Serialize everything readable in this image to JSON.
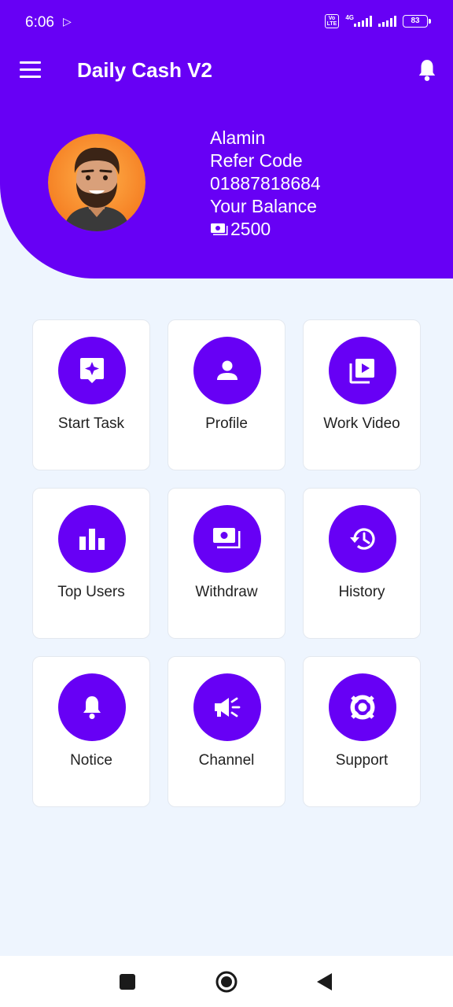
{
  "status_bar": {
    "time": "6:06",
    "network": "4G",
    "volte": "Vo LTE",
    "battery": "83"
  },
  "app_bar": {
    "title": "Daily Cash V2"
  },
  "profile": {
    "name": "Alamin",
    "refer_label": "Refer Code",
    "refer_code": "01887818684",
    "balance_label": "Your Balance",
    "balance": "2500"
  },
  "menu": [
    {
      "label": "Start Task",
      "icon": "task-sparkle-icon"
    },
    {
      "label": "Profile",
      "icon": "person-icon"
    },
    {
      "label": "Work Video",
      "icon": "video-library-icon"
    },
    {
      "label": "Top Users",
      "icon": "bar-chart-icon"
    },
    {
      "label": "Withdraw",
      "icon": "cash-icon"
    },
    {
      "label": "History",
      "icon": "history-icon"
    },
    {
      "label": "Notice",
      "icon": "bell-icon"
    },
    {
      "label": "Channel",
      "icon": "megaphone-icon"
    },
    {
      "label": "Support",
      "icon": "lifebuoy-icon"
    }
  ],
  "colors": {
    "primary": "#6700F5",
    "background": "#EEF5FE",
    "card": "#FFFFFF"
  }
}
